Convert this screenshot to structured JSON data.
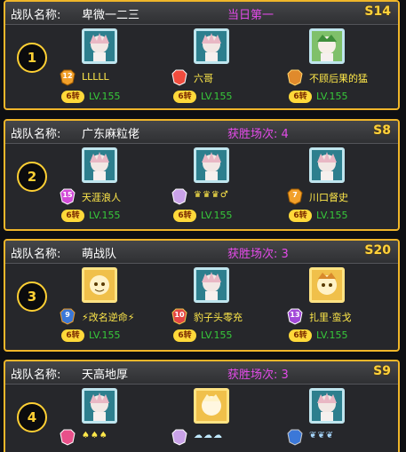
{
  "label": "战队名称:",
  "teams": [
    {
      "rank": "1",
      "name": "卑微一二三",
      "status": "当日第一",
      "server": "S14",
      "members": [
        {
          "medal": "12",
          "name": "LLLLL",
          "zhuan": "6转",
          "level": "LV.155",
          "avatar": "teal"
        },
        {
          "medal": "",
          "name": "六哥",
          "zhuan": "6转",
          "level": "LV.155",
          "avatar": "teal"
        },
        {
          "medal": "",
          "name": "不顾后果的猛",
          "zhuan": "6转",
          "level": "LV.155",
          "avatar": "green"
        }
      ]
    },
    {
      "rank": "2",
      "name": "广东麻粒佬",
      "status": "获胜场次: 4",
      "server": "S8",
      "members": [
        {
          "medal": "15",
          "name": "天涯浪人",
          "zhuan": "6转",
          "level": "LV.155",
          "avatar": "teal"
        },
        {
          "medal": "",
          "name": "♛♛♛♂",
          "zhuan": "6转",
          "level": "LV.155",
          "avatar": "teal"
        },
        {
          "medal": "7",
          "name": "川口督史",
          "zhuan": "6转",
          "level": "LV.155",
          "avatar": "teal"
        }
      ]
    },
    {
      "rank": "3",
      "name": "萌战队",
      "status": "获胜场次: 3",
      "server": "S20",
      "members": [
        {
          "medal": "9",
          "name": "⚡改名逆命⚡",
          "zhuan": "6转",
          "level": "LV.155",
          "avatar": "gold"
        },
        {
          "medal": "10",
          "name": "豹子头零充",
          "zhuan": "6转",
          "level": "LV.155",
          "avatar": "teal"
        },
        {
          "medal": "13",
          "name": "扎里·蛮戈",
          "zhuan": "6转",
          "level": "LV.155",
          "avatar": "gold"
        }
      ]
    },
    {
      "rank": "4",
      "name": "天高地厚",
      "status": "获胜场次: 3",
      "server": "S9",
      "members": [
        {
          "medal": "",
          "name": "♠♠♠",
          "zhuan": "",
          "level": "",
          "avatar": "teal"
        },
        {
          "medal": "",
          "name": "☁☁☁",
          "zhuan": "",
          "level": "",
          "avatar": "gold"
        },
        {
          "medal": "",
          "name": "❦❦❦",
          "zhuan": "",
          "level": "",
          "avatar": "teal"
        }
      ]
    }
  ],
  "colors": {
    "border": "#f0b62a",
    "status": "#e34be8",
    "server": "#ffd23a",
    "player_name": "#ffe84a",
    "level": "#37c93a",
    "zhuan_badge": "#ffd93a"
  }
}
